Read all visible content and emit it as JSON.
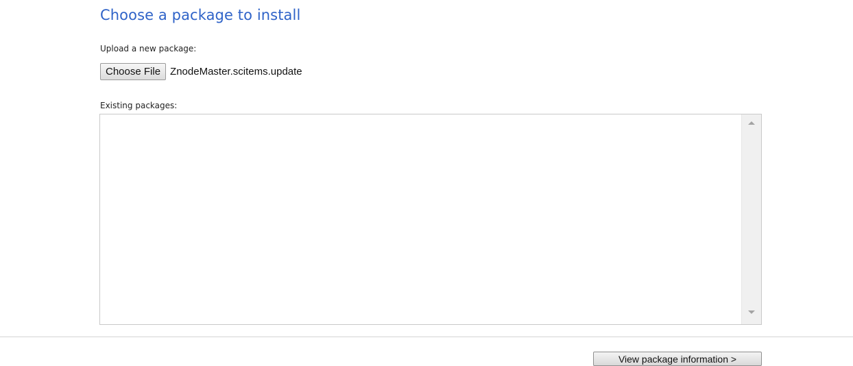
{
  "header": {
    "title": "Choose a package to install"
  },
  "upload": {
    "label": "Upload a new package:",
    "button_label": "Choose File",
    "selected_file": "ZnodeMaster.scitems.update"
  },
  "existing": {
    "label": "Existing packages:",
    "items": []
  },
  "footer": {
    "next_button_label": "View package information >"
  },
  "colors": {
    "title": "#2f63c8",
    "divider": "#d4d4d4"
  },
  "icons": {
    "scroll_up": "scroll-up-arrow",
    "scroll_down": "scroll-down-arrow"
  }
}
